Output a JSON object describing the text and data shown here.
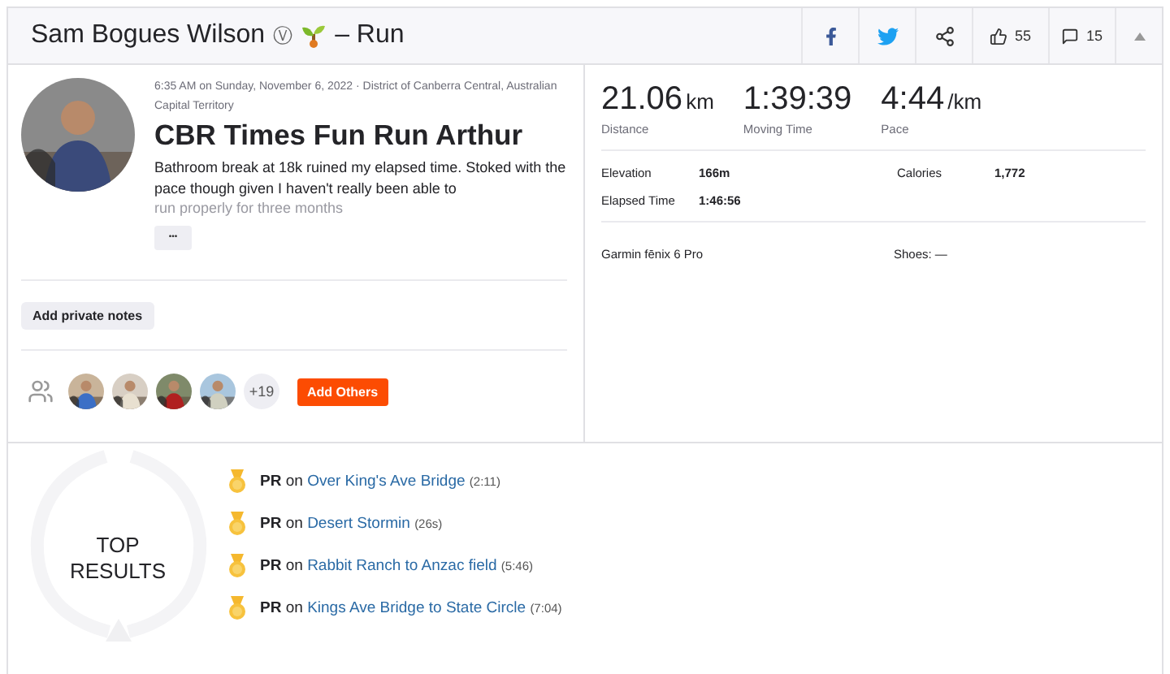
{
  "header": {
    "athlete": "Sam Bogues Wilson",
    "badge": "Ⓥ",
    "activity_type": "– Run",
    "kudos": "55",
    "comments": "15"
  },
  "activity": {
    "meta": "6:35 AM on Sunday, November 6, 2022 · District of Canberra Central, Australian Capital Territory",
    "title": "CBR Times Fun Run Arthur",
    "description": "Bathroom break at 18k ruined my elapsed time. Stoked with the pace though given I haven't really been able to",
    "description_faded": "run properly for three months",
    "more": "•••",
    "notes_button": "Add private notes"
  },
  "group": {
    "more_count": "+19",
    "add_button": "Add Others"
  },
  "stats": {
    "primary": [
      {
        "value": "21.06",
        "unit": "km",
        "label": "Distance"
      },
      {
        "value": "1:39:39",
        "label": "Moving Time"
      },
      {
        "value": "4:44",
        "unit": "/km",
        "label": "Pace"
      }
    ],
    "secondary": [
      {
        "label": "Elevation",
        "value": "166m"
      },
      {
        "label": "Calories",
        "value": "1,772"
      },
      {
        "label": "Elapsed Time",
        "value": "1:46:56"
      }
    ],
    "device": "Garmin fēnix 6 Pro",
    "shoes": "Shoes: —"
  },
  "top_results": {
    "title": "TOP RESULTS",
    "items": [
      {
        "achievement": "PR",
        "connector": "on",
        "segment": "Over King's Ave Bridge",
        "time": "(2:11)"
      },
      {
        "achievement": "PR",
        "connector": "on",
        "segment": "Desert Stormin",
        "time": "(26s)"
      },
      {
        "achievement": "PR",
        "connector": "on",
        "segment": "Rabbit Ranch to Anzac field",
        "time": "(5:46)"
      },
      {
        "achievement": "PR",
        "connector": "on",
        "segment": "Kings Ave Bridge to State Circle",
        "time": "(7:04)"
      }
    ]
  }
}
